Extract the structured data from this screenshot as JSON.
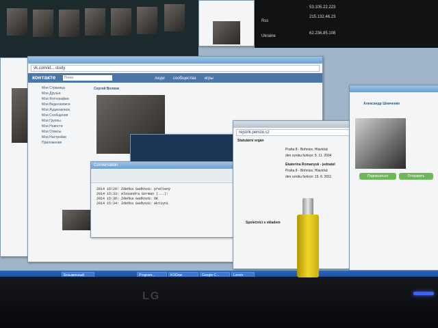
{
  "vk": {
    "logo": "контакте",
    "search": "Поиск",
    "tabs": [
      "люди",
      "сообщества",
      "игры"
    ],
    "user_name": "Сергей Волков",
    "menu": [
      "Моя Страница",
      "Мои Друзья",
      "Мои Фотографии",
      "Мои Видеозаписи",
      "Мои Аудиозаписи",
      "Мои Сообщения",
      "Мои Группы",
      "Мои Новости",
      "Мои Ответы",
      "Мои Настройки",
      "Приложения"
    ]
  },
  "browser_main": {
    "url": "vk.com/id... study"
  },
  "chat_window": {
    "title": "Conversation",
    "lines": [
      "2014 15:20:  Zdeňka Gadková: přečtený",
      "2014 15:33:  Alexandra Gorman (...):",
      "2014 15:36:  Zdeňka Gadková: OK",
      "2014 15:34:  Zdeňka Gadková: Aktivní"
    ]
  },
  "rejstrik": {
    "url": "rejstrik.penize.cz",
    "heading": "Statutární orgán",
    "entries": [
      "Praha 8 - Bohnice, Hlavická",
      "den vzniku funkce: 9. 11. 2004",
      "Ekaterina Romanyuk - jednatel",
      "Praha 8 - Bohnice, Hlavická",
      "den vzniku funkce: 15. 6. 2011",
      "Společníci s vkladem"
    ]
  },
  "profile_right": {
    "name": "Александр Шевченко",
    "buttons": [
      "Подписаться",
      "Отправить"
    ]
  },
  "finance": {
    "labels": [
      "Rss",
      "Ukraine"
    ],
    "values": [
      "53.105.22.223",
      "215.132.46.23",
      "62.236.85.108"
    ]
  },
  "taskbar": {
    "items": [
      "Безымянный",
      "Program...",
      "KODow",
      "Google C...",
      "Lorem"
    ]
  },
  "monitor_brand": "LG"
}
